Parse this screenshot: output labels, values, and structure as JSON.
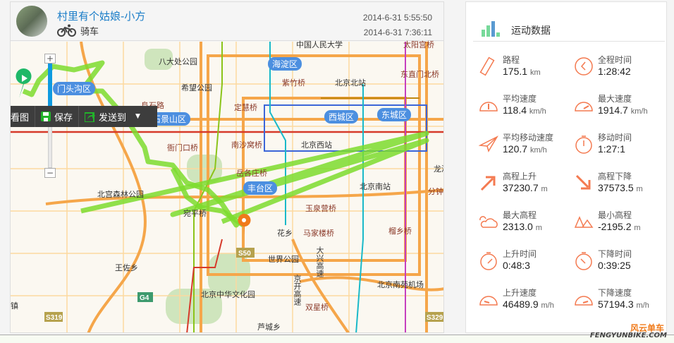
{
  "header": {
    "username": "村里有个姑娘-小方",
    "sport": "骑车",
    "sport_icon": "bicycle-icon",
    "start_time": "2014-6-31 5:55:50",
    "end_time": "2014-6-31 7:36:11"
  },
  "toolbar": {
    "view_label": "看图",
    "save_label": "保存",
    "send_label": "发送到"
  },
  "map": {
    "districts": [
      "门头沟区",
      "石景山区",
      "海淀区",
      "西城区",
      "东城区",
      "丰台区"
    ],
    "places": [
      "八大处公园",
      "希望公园",
      "阜石路",
      "衙门口桥",
      "定慧桥",
      "紫竹桥",
      "北京北站",
      "东直门北桥",
      "太阳宫桥",
      "中国人民大学",
      "南沙窝桥",
      "北京西站",
      "岳各庄桥",
      "北京南站",
      "龙潭公",
      "分钟寺桥",
      "北宫森林公园",
      "玉泉营桥",
      "马家楼桥",
      "花乡",
      "世界公园",
      "宛平桥",
      "王佐乡",
      "北京中华文化园",
      "北京南苑机场",
      "双星桥",
      "芦城乡",
      "榴乡桥",
      "大兴高速",
      "京开高速",
      "镇"
    ],
    "road_shields": [
      "S50",
      "G4",
      "S319",
      "S329"
    ],
    "track_color": "#7ddc2e"
  },
  "panel": {
    "title": "运动数据",
    "stats": [
      {
        "label": "路程",
        "value": "175.1",
        "unit": "km",
        "icon": "ruler-icon"
      },
      {
        "label": "全程时间",
        "value": "1:28:42",
        "unit": "",
        "icon": "clock-icon"
      },
      {
        "label": "平均速度",
        "value": "118.4",
        "unit": "km/h",
        "icon": "speedometer-icon"
      },
      {
        "label": "最大速度",
        "value": "1914.7",
        "unit": "km/h",
        "icon": "speedometer-max-icon"
      },
      {
        "label": "平均移动速度",
        "value": "120.7",
        "unit": "km/h",
        "icon": "paper-plane-icon"
      },
      {
        "label": "移动时间",
        "value": "1:27:1",
        "unit": "",
        "icon": "stopwatch-icon"
      },
      {
        "label": "高程上升",
        "value": "37230.7",
        "unit": "m",
        "icon": "arrow-up-right-icon"
      },
      {
        "label": "高程下降",
        "value": "37573.5",
        "unit": "m",
        "icon": "arrow-down-right-icon"
      },
      {
        "label": "最大高程",
        "value": "2313.0",
        "unit": "m",
        "icon": "cloud-icon"
      },
      {
        "label": "最小高程",
        "value": "-2195.2",
        "unit": "m",
        "icon": "mountain-icon"
      },
      {
        "label": "上升时间",
        "value": "0:48:3",
        "unit": "",
        "icon": "stopwatch-up-icon"
      },
      {
        "label": "下降时间",
        "value": "0:39:25",
        "unit": "",
        "icon": "stopwatch-down-icon"
      },
      {
        "label": "上升速度",
        "value": "46489.9",
        "unit": "m/h",
        "icon": "gauge-up-icon"
      },
      {
        "label": "下降速度",
        "value": "57194.3",
        "unit": "m/h",
        "icon": "gauge-down-icon"
      }
    ],
    "accent": "#f47a50"
  },
  "watermark": {
    "cn": "风云单车",
    "en": "FENGYUNBIKE.COM"
  }
}
